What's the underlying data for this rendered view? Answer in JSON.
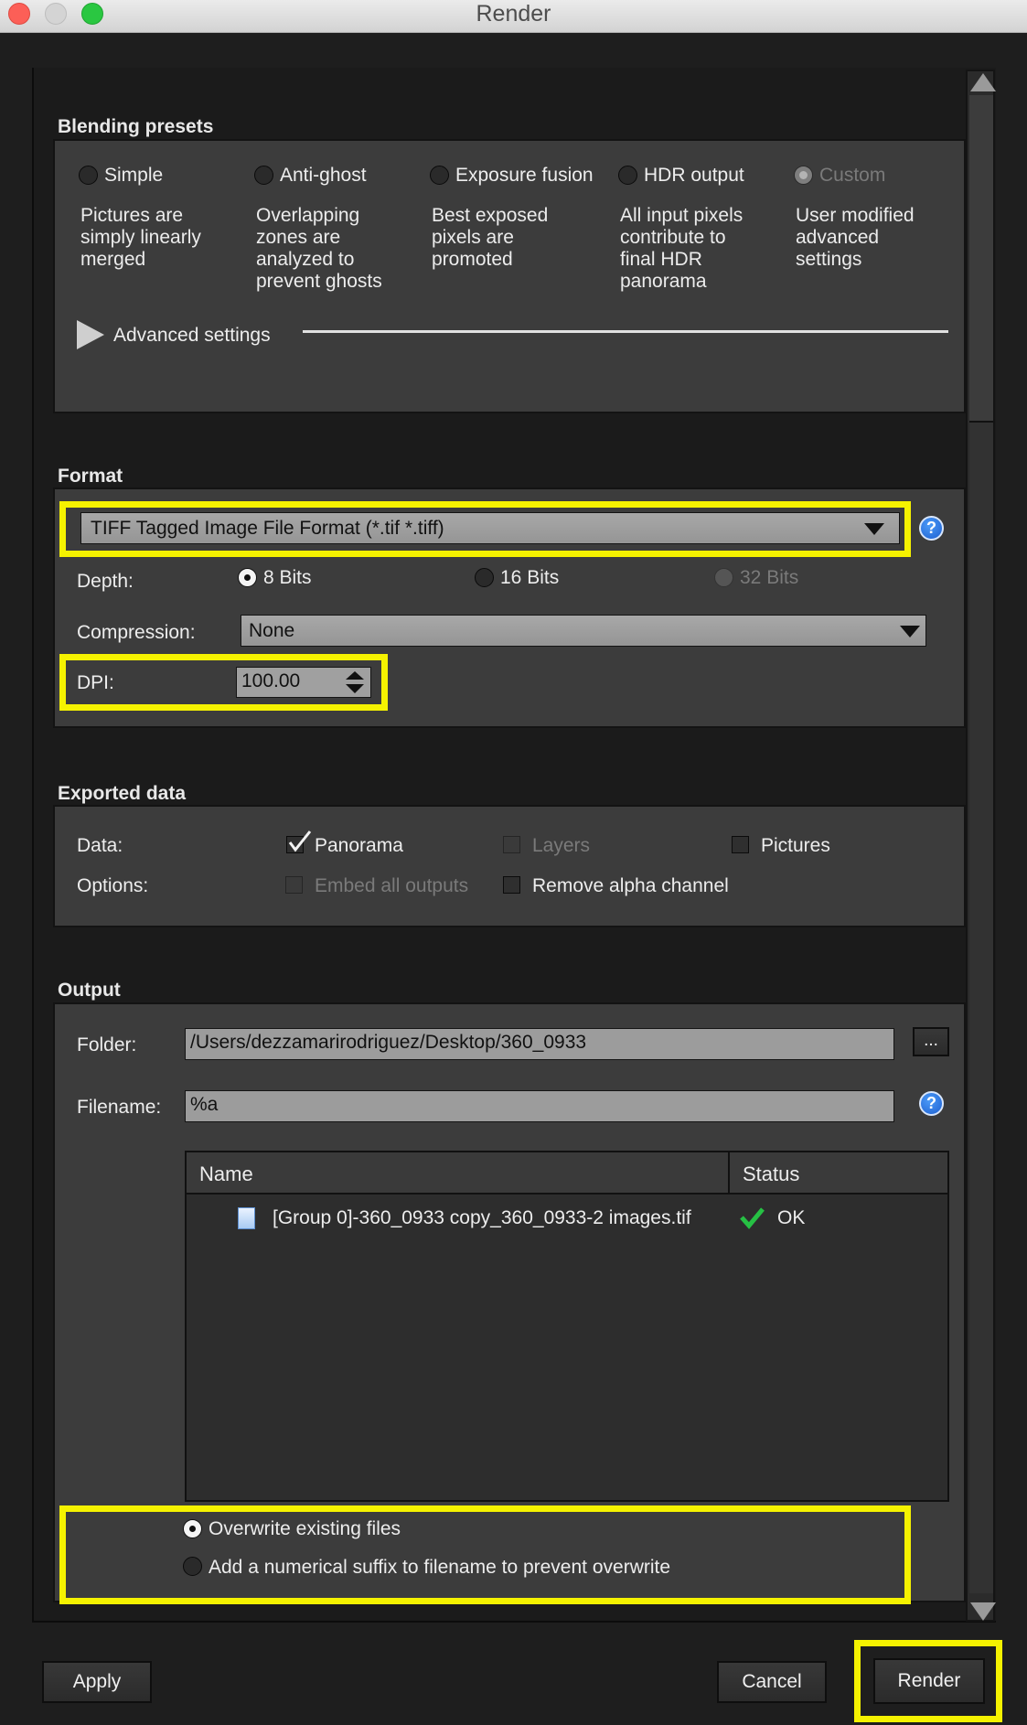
{
  "window": {
    "title": "Render"
  },
  "blending": {
    "title": "Blending presets",
    "presets": [
      {
        "label": "Simple",
        "desc": [
          "Pictures are",
          "simply linearly",
          "merged"
        ]
      },
      {
        "label": "Anti-ghost",
        "desc": [
          "Overlapping",
          "zones are",
          "analyzed to",
          "prevent ghosts"
        ]
      },
      {
        "label": "Exposure fusion",
        "desc": [
          "Best exposed",
          "pixels are",
          "promoted"
        ]
      },
      {
        "label": "HDR output",
        "desc": [
          "All input pixels",
          "contribute to",
          "final HDR",
          "panorama"
        ]
      },
      {
        "label": "Custom",
        "desc": [
          "User modified",
          "advanced",
          "settings"
        ]
      }
    ],
    "advanced_label": "Advanced settings"
  },
  "format": {
    "title": "Format",
    "format_value": "TIFF Tagged Image File Format (*.tif *.tiff)",
    "depth_label": "Depth:",
    "depth_options": [
      "8 Bits",
      "16 Bits",
      "32 Bits"
    ],
    "depth_selected": "8 Bits",
    "compression_label": "Compression:",
    "compression_value": "None",
    "dpi_label": "DPI:",
    "dpi_value": "100.00",
    "help_glyph": "?"
  },
  "exported": {
    "title": "Exported data",
    "data_label": "Data:",
    "panorama": "Panorama",
    "layers": "Layers",
    "pictures": "Pictures",
    "options_label": "Options:",
    "embed": "Embed all outputs",
    "remove_alpha": "Remove alpha channel",
    "panorama_checked": true
  },
  "output": {
    "title": "Output",
    "folder_label": "Folder:",
    "folder_value": "/Users/dezzamarirodriguez/Desktop/360_0933",
    "browse_label": "...",
    "filename_label": "Filename:",
    "filename_value": "%a",
    "table": {
      "col_name": "Name",
      "col_status": "Status",
      "rows": [
        {
          "name": "[Group 0]-360_0933 copy_360_0933-2 images.tif",
          "status": "OK"
        }
      ]
    },
    "overwrite": "Overwrite existing files",
    "suffix": "Add a numerical suffix to filename to prevent overwrite",
    "overwrite_selected": true
  },
  "buttons": {
    "apply": "Apply",
    "cancel": "Cancel",
    "render": "Render"
  },
  "colors": {
    "highlight": "#f5f200",
    "panel": "#3c3c3c",
    "ok_check": "#26c044",
    "help": "#2f7be8"
  }
}
